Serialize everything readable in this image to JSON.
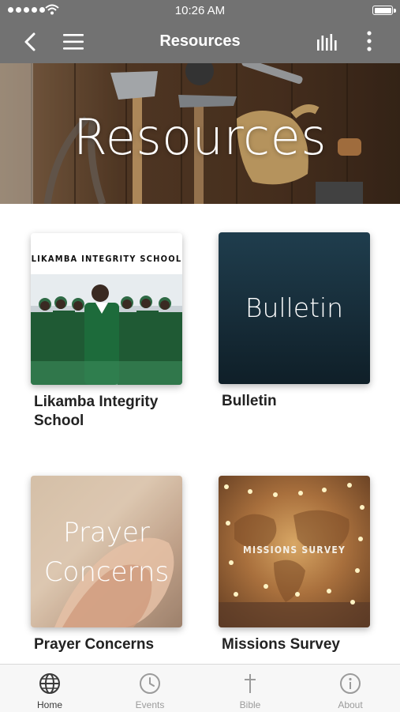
{
  "status_bar": {
    "time": "10:26 AM"
  },
  "nav": {
    "title": "Resources",
    "back_icon": "back-chevron-icon",
    "menu_icon": "hamburger-menu-icon",
    "audio_icon": "audio-bars-icon",
    "more_icon": "more-vertical-icon"
  },
  "hero": {
    "title": "Resources"
  },
  "cards": [
    {
      "label": "Likamba Integrity School",
      "thumb_text": "LIKAMBA INTEGRITY SCHOOL"
    },
    {
      "label": "Bulletin",
      "thumb_text": "Bulletin"
    },
    {
      "label": "Prayer Concerns",
      "thumb_text_line1": "Prayer",
      "thumb_text_line2": "Concerns"
    },
    {
      "label": "Missions Survey",
      "thumb_text": "MISSIONS SURVEY"
    }
  ],
  "tabs": [
    {
      "label": "Home",
      "icon": "globe-icon",
      "active": true
    },
    {
      "label": "Events",
      "icon": "clock-icon",
      "active": false
    },
    {
      "label": "Bible",
      "icon": "cross-icon",
      "active": false
    },
    {
      "label": "About",
      "icon": "info-icon",
      "active": false
    }
  ],
  "colors": {
    "bar_gray": "#727272",
    "bulletin_bg": "#1d3645",
    "tab_active": "#3a3a3a",
    "tab_inactive": "#9b9b9b"
  }
}
